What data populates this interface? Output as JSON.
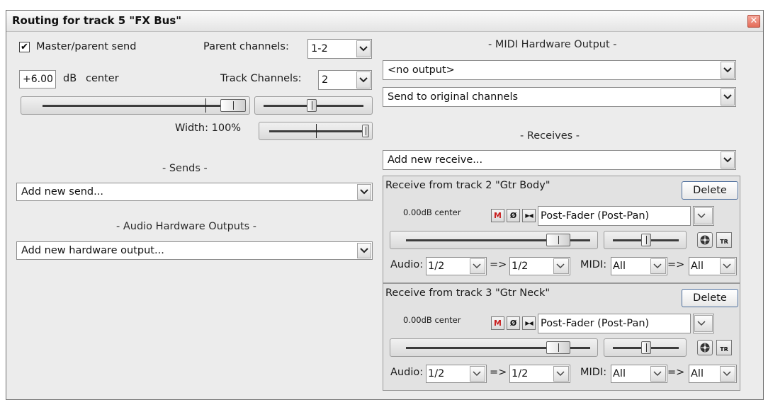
{
  "window": {
    "title": "Routing for track 5 \"FX Bus\"",
    "close_glyph": "✕"
  },
  "left": {
    "master_send": {
      "checked": true,
      "check_glyph": "✔",
      "label": "Master/parent send"
    },
    "parent_channels": {
      "label": "Parent channels:",
      "value": "1-2"
    },
    "volume": {
      "value": "+6.00",
      "unit": "dB",
      "pan": "center"
    },
    "track_channels": {
      "label": "Track Channels:",
      "value": "2"
    },
    "width": {
      "label": "Width: 100%",
      "value": 1.0
    },
    "volume_slider_level": 0.93,
    "pan_slider_level": 0.5,
    "sends": {
      "header": "- Sends -",
      "combo": "Add new send..."
    },
    "hw_outputs": {
      "header": "- Audio Hardware Outputs -",
      "combo": "Add new hardware output..."
    }
  },
  "right": {
    "midi_hw": {
      "header": "- MIDI Hardware Output -",
      "output": "<no output>",
      "channels": "Send to original channels"
    },
    "receives": {
      "header": "- Receives -",
      "combo": "Add new receive...",
      "items": [
        {
          "title": "Receive from track 2 \"Gtr Body\"",
          "delete_label": "Delete",
          "level": "0.00dB center",
          "mute": "M",
          "phase": "Ø",
          "mono": "▶◀",
          "mode": "Post-Fader (Post-Pan)",
          "audio_label": "Audio:",
          "audio_src": "1/2",
          "arrow": "=>",
          "audio_dst": "1/2",
          "midi_label": "MIDI:",
          "midi_src": "All",
          "midi_arrow": "=>",
          "midi_dst": "All",
          "tr_label": "TR",
          "volume_level": 0.78,
          "pan_level": 0.5
        },
        {
          "title": "Receive from track 3 \"Gtr Neck\"",
          "delete_label": "Delete",
          "level": "0.00dB center",
          "mute": "M",
          "phase": "Ø",
          "mono": "▶◀",
          "mode": "Post-Fader (Post-Pan)",
          "audio_label": "Audio:",
          "audio_src": "1/2",
          "arrow": "=>",
          "audio_dst": "1/2",
          "midi_label": "MIDI:",
          "midi_src": "All",
          "midi_arrow": "=>",
          "midi_dst": "All",
          "tr_label": "TR",
          "volume_level": 0.78,
          "pan_level": 0.5
        }
      ]
    }
  },
  "colors": {
    "mute_red": "#c81e1e",
    "close_red": "#e46b58",
    "dialog_bg": "#ececec"
  }
}
